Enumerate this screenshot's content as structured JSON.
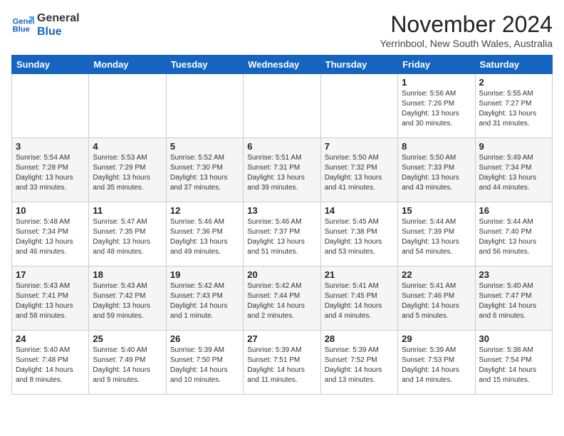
{
  "logo": {
    "line1": "General",
    "line2": "Blue"
  },
  "title": "November 2024",
  "location": "Yerrinbool, New South Wales, Australia",
  "days_of_week": [
    "Sunday",
    "Monday",
    "Tuesday",
    "Wednesday",
    "Thursday",
    "Friday",
    "Saturday"
  ],
  "weeks": [
    [
      {
        "day": "",
        "info": ""
      },
      {
        "day": "",
        "info": ""
      },
      {
        "day": "",
        "info": ""
      },
      {
        "day": "",
        "info": ""
      },
      {
        "day": "",
        "info": ""
      },
      {
        "day": "1",
        "info": "Sunrise: 5:56 AM\nSunset: 7:26 PM\nDaylight: 13 hours\nand 30 minutes."
      },
      {
        "day": "2",
        "info": "Sunrise: 5:55 AM\nSunset: 7:27 PM\nDaylight: 13 hours\nand 31 minutes."
      }
    ],
    [
      {
        "day": "3",
        "info": "Sunrise: 5:54 AM\nSunset: 7:28 PM\nDaylight: 13 hours\nand 33 minutes."
      },
      {
        "day": "4",
        "info": "Sunrise: 5:53 AM\nSunset: 7:29 PM\nDaylight: 13 hours\nand 35 minutes."
      },
      {
        "day": "5",
        "info": "Sunrise: 5:52 AM\nSunset: 7:30 PM\nDaylight: 13 hours\nand 37 minutes."
      },
      {
        "day": "6",
        "info": "Sunrise: 5:51 AM\nSunset: 7:31 PM\nDaylight: 13 hours\nand 39 minutes."
      },
      {
        "day": "7",
        "info": "Sunrise: 5:50 AM\nSunset: 7:32 PM\nDaylight: 13 hours\nand 41 minutes."
      },
      {
        "day": "8",
        "info": "Sunrise: 5:50 AM\nSunset: 7:33 PM\nDaylight: 13 hours\nand 43 minutes."
      },
      {
        "day": "9",
        "info": "Sunrise: 5:49 AM\nSunset: 7:34 PM\nDaylight: 13 hours\nand 44 minutes."
      }
    ],
    [
      {
        "day": "10",
        "info": "Sunrise: 5:48 AM\nSunset: 7:34 PM\nDaylight: 13 hours\nand 46 minutes."
      },
      {
        "day": "11",
        "info": "Sunrise: 5:47 AM\nSunset: 7:35 PM\nDaylight: 13 hours\nand 48 minutes."
      },
      {
        "day": "12",
        "info": "Sunrise: 5:46 AM\nSunset: 7:36 PM\nDaylight: 13 hours\nand 49 minutes."
      },
      {
        "day": "13",
        "info": "Sunrise: 5:46 AM\nSunset: 7:37 PM\nDaylight: 13 hours\nand 51 minutes."
      },
      {
        "day": "14",
        "info": "Sunrise: 5:45 AM\nSunset: 7:38 PM\nDaylight: 13 hours\nand 53 minutes."
      },
      {
        "day": "15",
        "info": "Sunrise: 5:44 AM\nSunset: 7:39 PM\nDaylight: 13 hours\nand 54 minutes."
      },
      {
        "day": "16",
        "info": "Sunrise: 5:44 AM\nSunset: 7:40 PM\nDaylight: 13 hours\nand 56 minutes."
      }
    ],
    [
      {
        "day": "17",
        "info": "Sunrise: 5:43 AM\nSunset: 7:41 PM\nDaylight: 13 hours\nand 58 minutes."
      },
      {
        "day": "18",
        "info": "Sunrise: 5:43 AM\nSunset: 7:42 PM\nDaylight: 13 hours\nand 59 minutes."
      },
      {
        "day": "19",
        "info": "Sunrise: 5:42 AM\nSunset: 7:43 PM\nDaylight: 14 hours\nand 1 minute."
      },
      {
        "day": "20",
        "info": "Sunrise: 5:42 AM\nSunset: 7:44 PM\nDaylight: 14 hours\nand 2 minutes."
      },
      {
        "day": "21",
        "info": "Sunrise: 5:41 AM\nSunset: 7:45 PM\nDaylight: 14 hours\nand 4 minutes."
      },
      {
        "day": "22",
        "info": "Sunrise: 5:41 AM\nSunset: 7:46 PM\nDaylight: 14 hours\nand 5 minutes."
      },
      {
        "day": "23",
        "info": "Sunrise: 5:40 AM\nSunset: 7:47 PM\nDaylight: 14 hours\nand 6 minutes."
      }
    ],
    [
      {
        "day": "24",
        "info": "Sunrise: 5:40 AM\nSunset: 7:48 PM\nDaylight: 14 hours\nand 8 minutes."
      },
      {
        "day": "25",
        "info": "Sunrise: 5:40 AM\nSunset: 7:49 PM\nDaylight: 14 hours\nand 9 minutes."
      },
      {
        "day": "26",
        "info": "Sunrise: 5:39 AM\nSunset: 7:50 PM\nDaylight: 14 hours\nand 10 minutes."
      },
      {
        "day": "27",
        "info": "Sunrise: 5:39 AM\nSunset: 7:51 PM\nDaylight: 14 hours\nand 11 minutes."
      },
      {
        "day": "28",
        "info": "Sunrise: 5:39 AM\nSunset: 7:52 PM\nDaylight: 14 hours\nand 13 minutes."
      },
      {
        "day": "29",
        "info": "Sunrise: 5:39 AM\nSunset: 7:53 PM\nDaylight: 14 hours\nand 14 minutes."
      },
      {
        "day": "30",
        "info": "Sunrise: 5:38 AM\nSunset: 7:54 PM\nDaylight: 14 hours\nand 15 minutes."
      }
    ]
  ]
}
